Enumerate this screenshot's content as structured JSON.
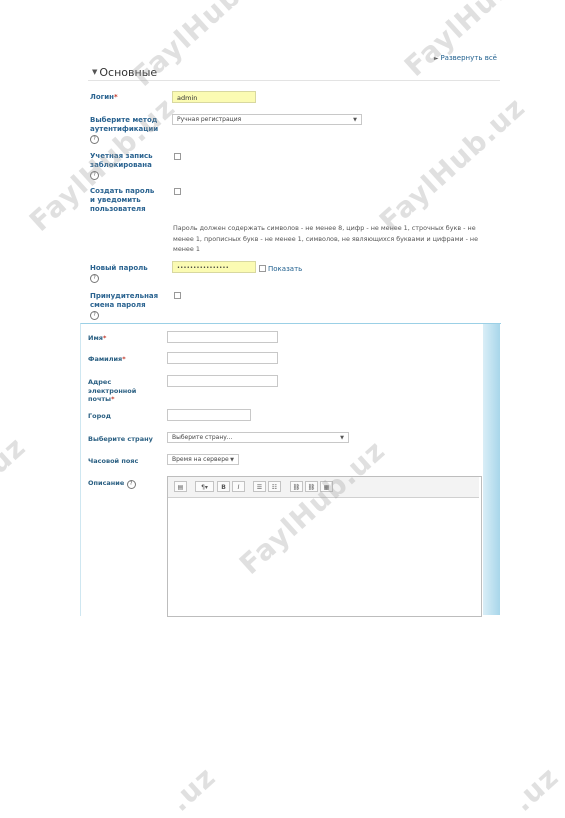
{
  "header": {
    "expand_all": "Развернуть всё",
    "section": "Основные"
  },
  "form": {
    "login_label": "Логин",
    "login_value": "admin",
    "auth_label": "Выберите метод аутентификации",
    "auth_value": "Ручная регистрация",
    "locked_label": "Учетная запись заблокирована",
    "create_pass_label": "Создать пароль и уведомить пользователя",
    "password_rules": "Пароль должен содержать символов - не менее 8, цифр - не менее 1, строчных букв - не менее 1, прописных букв - не менее 1, символов, не являющихся буквами и цифрами - не менее 1",
    "new_password_label": "Новый пароль",
    "new_password_value": "••••••••••••••••",
    "show_label": "Показать",
    "force_change_label": "Принудительная смена пароля"
  },
  "form2": {
    "first_name_label": "Имя",
    "last_name_label": "Фамилия",
    "email_label": "Адрес электронной почты",
    "city_label": "Город",
    "country_label": "Выберите страну",
    "country_value": "Выберите страну...",
    "timezone_label": "Часовой пояс",
    "timezone_value": "Время на сервере",
    "description_label": "Описание"
  },
  "editor_toolbar": [
    "▤",
    "¶▾",
    "B",
    "I",
    "☰",
    "☷",
    "⛓",
    "⛓",
    "▦"
  ],
  "watermarks": [
    "FaylHub.uz",
    "FaylHub.uz",
    "FaylHub.uz",
    "FaylHub.uz",
    ".uz",
    "FaylHub.uz",
    ".uz",
    ".uz"
  ],
  "colors": {
    "label": "#2a6390",
    "accent_field": "#fbfbb3",
    "required": "#c0392b"
  },
  "icons": [
    "help-icon",
    "caret-down-icon",
    "expand-arrow-icon",
    "collapse-triangle-icon"
  ]
}
